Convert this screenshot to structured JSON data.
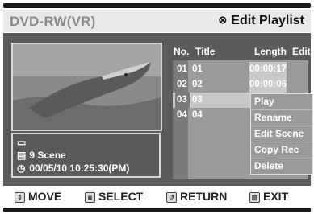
{
  "header": {
    "source": "DVD-RW(VR)",
    "menu_title": "Edit Playlist",
    "menu_icon": "disc-icon"
  },
  "preview": {
    "image_desc": "dolphin"
  },
  "info": {
    "scene_count": "9 Scene",
    "datetime": "00/05/10   10:25:30(PM)"
  },
  "list": {
    "columns": {
      "no": "No.",
      "title": "Title",
      "length": "Length",
      "edit": "Edit"
    },
    "rows": [
      {
        "no": "01",
        "title": "01",
        "length": "00:00:17"
      },
      {
        "no": "02",
        "title": "02",
        "length": "00:00:06"
      },
      {
        "no": "03",
        "title": "03",
        "length": ""
      },
      {
        "no": "04",
        "title": "04",
        "length": ""
      }
    ],
    "selected_index": 2
  },
  "popup": {
    "items": [
      "Play",
      "Rename",
      "Edit Scene",
      "Copy Rec",
      "Delete"
    ]
  },
  "footer": {
    "move": "MOVE",
    "select": "SELECT",
    "return": "RETURN",
    "exit": "EXIT"
  },
  "colors": {
    "background": "#ffffff",
    "panel": "#5a5a5a",
    "list": "#9a9a9a",
    "highlight": "#c8c8c8"
  }
}
